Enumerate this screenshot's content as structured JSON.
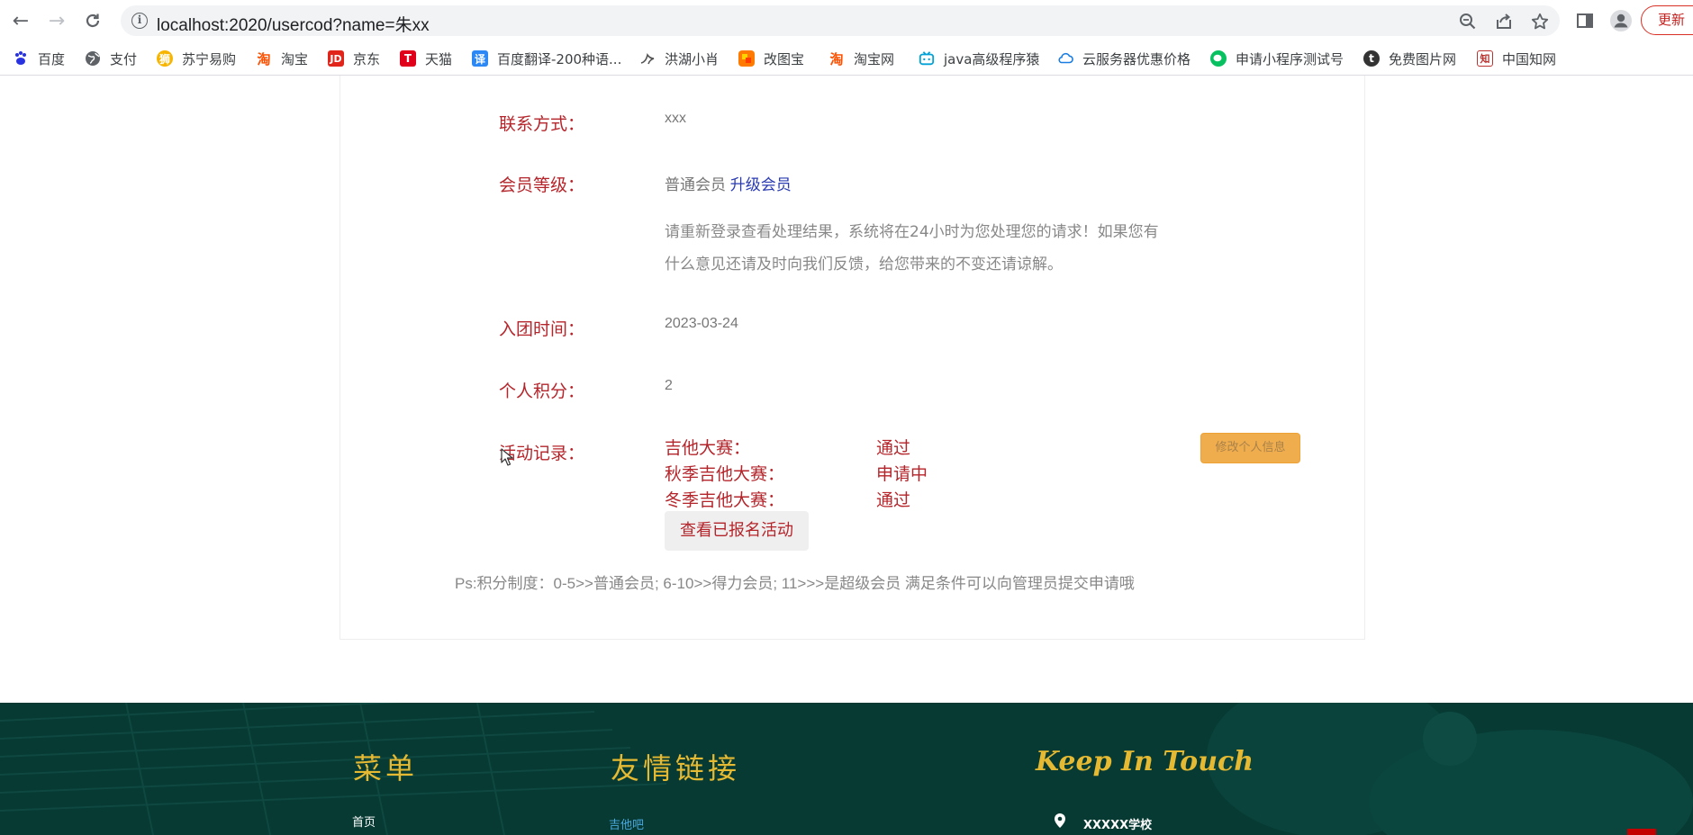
{
  "browser": {
    "url": "localhost:2020/usercod?name=朱xx",
    "update_label": "更新"
  },
  "bookmarks": [
    {
      "label": "百度",
      "icon": "baidu-paw-icon",
      "color": "#2932e1"
    },
    {
      "label": "支付",
      "icon": "globe-icon",
      "color": "#5f6368"
    },
    {
      "label": "苏宁易购",
      "icon": "suning-lion-icon",
      "color": "#f7b500"
    },
    {
      "label": "淘宝",
      "icon": "taobao-icon",
      "color": "#ff5000"
    },
    {
      "label": "京东",
      "icon": "jd-icon",
      "color": "#e1251b"
    },
    {
      "label": "天猫",
      "icon": "tmall-icon",
      "color": "#e1001a"
    },
    {
      "label": "百度翻译-200种语...",
      "icon": "translate-icon",
      "color": "#2c88f5"
    },
    {
      "label": "洪湖小肖",
      "icon": "bird-icon",
      "color": "#555555"
    },
    {
      "label": "改图宝",
      "icon": "gaitubao-icon",
      "color": "#ff7a00"
    },
    {
      "label": "淘宝网",
      "icon": "taobao-icon",
      "color": "#ff5000"
    },
    {
      "label": "java高级程序猿",
      "icon": "bilibili-icon",
      "color": "#00a1d6"
    },
    {
      "label": "云服务器优惠价格",
      "icon": "cloud-icon",
      "color": "#1a7de1"
    },
    {
      "label": "申请小程序测试号",
      "icon": "wechat-icon",
      "color": "#07c160"
    },
    {
      "label": "免费图片网",
      "icon": "t-icon",
      "color": "#333333"
    },
    {
      "label": "中国知网",
      "icon": "cnki-icon",
      "color": "#b8322f"
    }
  ],
  "profile": {
    "contact_label": "联系方式：",
    "contact_value": "xxx",
    "level_label": "会员等级：",
    "level_value": "普通会员",
    "upgrade_link": "升级会员",
    "note_line1": "请重新登录查看处理结果，系统将在24小时为您处理您的请求！如果您有",
    "note_line2": "什么意见还请及时向我们反馈，给您带来的不变还请谅解。",
    "join_label": "入团时间：",
    "join_value": "2023-03-24",
    "points_label": "个人积分：",
    "points_value": "2",
    "activity_label": "活动记录：",
    "activities": [
      {
        "name": "吉他大赛：",
        "status": "通过"
      },
      {
        "name": "秋季吉他大赛：",
        "status": "申请中"
      },
      {
        "name": "冬季吉他大赛：",
        "status": "通过"
      }
    ],
    "view_button": "查看已报名活动",
    "edit_button": "修改个人信息",
    "ps_note": "Ps:积分制度：0-5>>普通会员; 6-10>>得力会员; 11>>>是超级会员 满足条件可以向管理员提交申请哦"
  },
  "footer": {
    "menu_title": "菜单",
    "friends_title": "友情链接",
    "keep_title": "Keep In Touch",
    "menu_first": "首页",
    "friends_first": "吉他吧",
    "school": "XXXXX学校"
  },
  "colors": {
    "label_red": "#b4252b",
    "footer_bg": "#063a33",
    "footer_gold": "#e6b932",
    "edit_button": "#f0ad4e"
  }
}
